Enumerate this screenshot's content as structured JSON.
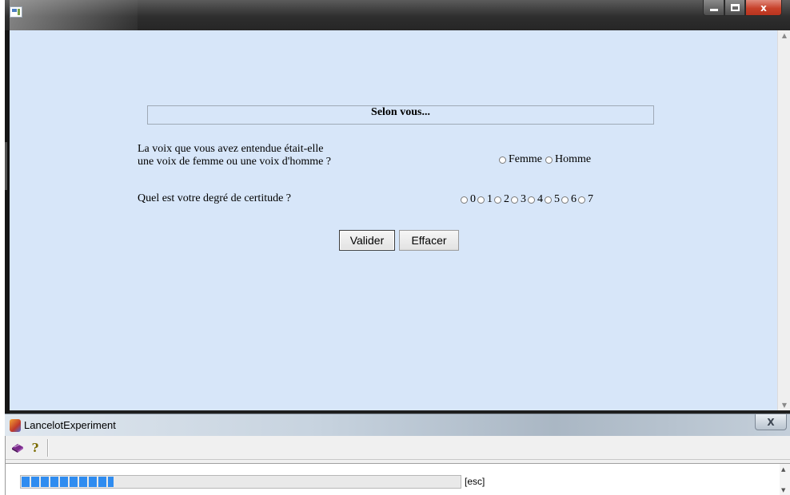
{
  "browser_window": {
    "controls": {
      "minimize": "–",
      "maximize": "□",
      "close": "x"
    }
  },
  "questionnaire": {
    "title": "Selon vous...",
    "question_gender": {
      "line1": "La voix que vous avez entendue était-elle",
      "line2": "une voix de femme ou une voix d'homme ?",
      "options": [
        "Femme",
        "Homme"
      ]
    },
    "question_certainty": {
      "text": "Quel est votre degré de certitude ?",
      "options": [
        "0",
        "1",
        "2",
        "3",
        "4",
        "5",
        "6",
        "7"
      ]
    },
    "buttons": {
      "submit": "Valider",
      "clear": "Effacer"
    }
  },
  "experiment_window": {
    "title": "LancelotExperiment",
    "close_label": "X",
    "toolbar": {
      "help_glyph": "?"
    },
    "progress": {
      "value_fraction": 0.21
    },
    "esc_label": "[esc]"
  },
  "colors": {
    "content_bg": "#d7e6f9",
    "progress_fill": "#2f8cf0",
    "close_button": "#c7412a"
  },
  "icons": [
    "app-icon",
    "lancelot-icon",
    "book-icon",
    "help-icon"
  ]
}
